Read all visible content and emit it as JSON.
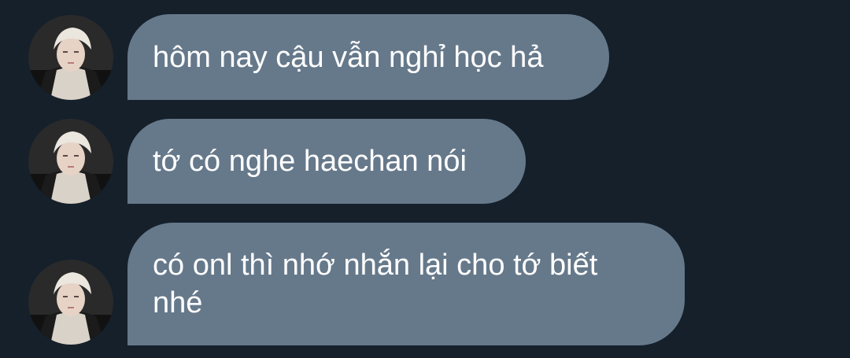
{
  "messages": [
    {
      "text": "hôm nay cậu vẫn nghỉ học hả"
    },
    {
      "text": "tớ có nghe haechan nói"
    },
    {
      "text": "có onl thì nhớ nhắn lại cho tớ biết nhé"
    }
  ],
  "colors": {
    "background": "#15202b",
    "bubble": "#66798b",
    "text": "#ffffff"
  },
  "icons": {
    "avatar": "user-avatar-icon"
  }
}
